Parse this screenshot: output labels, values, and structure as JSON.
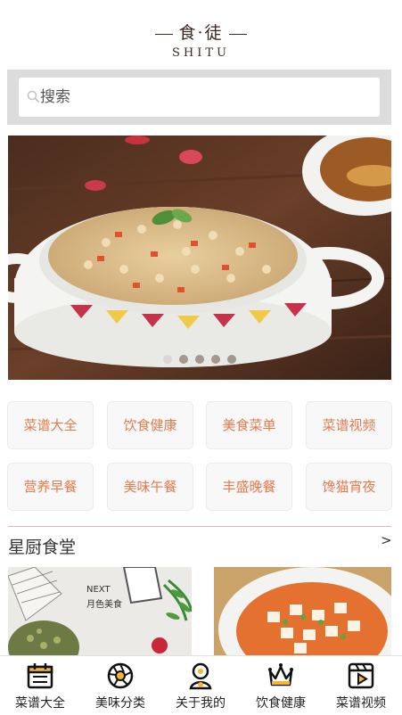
{
  "header": {
    "logo_cn_left": "食",
    "logo_cn_dot": "·",
    "logo_cn_right": "徒",
    "logo_en": "SHITU"
  },
  "search": {
    "placeholder": "搜索",
    "icon": "search-icon"
  },
  "carousel": {
    "slide_count": 5,
    "active_index": 0
  },
  "categories": [
    "菜谱大全",
    "饮食健康",
    "美食菜单",
    "菜谱视频",
    "营养早餐",
    "美味午餐",
    "丰盛晚餐",
    "馋猫宵夜"
  ],
  "section": {
    "title": "星厨食堂",
    "more": ">"
  },
  "thumb_card": {
    "tag_en": "NEXT",
    "tag_cn": "月色美食"
  },
  "tabbar": [
    {
      "label": "菜谱大全",
      "icon": "calendar-icon"
    },
    {
      "label": "美味分类",
      "icon": "aperture-icon"
    },
    {
      "label": "关于我的",
      "icon": "person-icon"
    },
    {
      "label": "饮食健康",
      "icon": "crown-icon"
    },
    {
      "label": "菜谱视频",
      "icon": "video-icon"
    }
  ],
  "colors": {
    "category_text": "#e07b4f",
    "search_bg": "#dcdcdc",
    "divider": "#d7b7c4"
  }
}
